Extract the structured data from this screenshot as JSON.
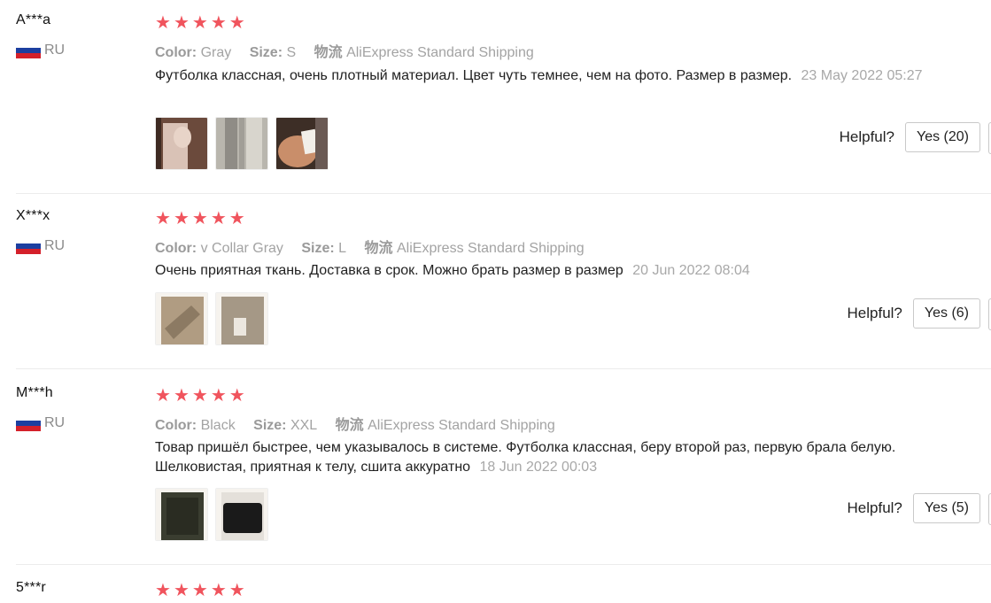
{
  "reviews": [
    {
      "user": "A***a",
      "country": "RU",
      "rating": 5,
      "color_label": "Color:",
      "color_value": "Gray",
      "size_label": "Size:",
      "size_value": "S",
      "shipping_label": "物流",
      "shipping_value": "AliExpress Standard Shipping",
      "text": "Футболка классная, очень плотный материал. Цвет чуть темнее, чем на фото. Размер в размер.",
      "date": "23 May 2022 05:27",
      "photos": [
        "photo-1",
        "photo-2",
        "photo-3"
      ],
      "helpful_label": "Helpful?",
      "yes_label": "Yes (20)"
    },
    {
      "user": "X***x",
      "country": "RU",
      "rating": 5,
      "color_label": "Color:",
      "color_value": "v Collar Gray",
      "size_label": "Size:",
      "size_value": "L",
      "shipping_label": "物流",
      "shipping_value": "AliExpress Standard Shipping",
      "text": "Очень приятная ткань. Доставка в срок. Можно брать размер в размер",
      "date": "20 Jun 2022 08:04",
      "photos": [
        "photo-1",
        "photo-2"
      ],
      "helpful_label": "Helpful?",
      "yes_label": "Yes (6)"
    },
    {
      "user": "M***h",
      "country": "RU",
      "rating": 5,
      "color_label": "Color:",
      "color_value": "Black",
      "size_label": "Size:",
      "size_value": "XXL",
      "shipping_label": "物流",
      "shipping_value": "AliExpress Standard Shipping",
      "text": "Товар пришёл быстрее, чем указывалось в системе. Футболка классная, беру второй раз, первую брала белую. Шелковистая, приятная к телу, сшита аккуратно",
      "date": "18 Jun 2022 00:03",
      "photos": [
        "photo-1",
        "photo-2"
      ],
      "helpful_label": "Helpful?",
      "yes_label": "Yes (5)"
    },
    {
      "user": "5***r",
      "rating": 5
    }
  ],
  "colors": {
    "star": "#f0545d",
    "muted": "#a3a3a3",
    "text": "#222222"
  },
  "icons": {
    "star": "star-icon",
    "flag": "russia-flag-icon"
  }
}
